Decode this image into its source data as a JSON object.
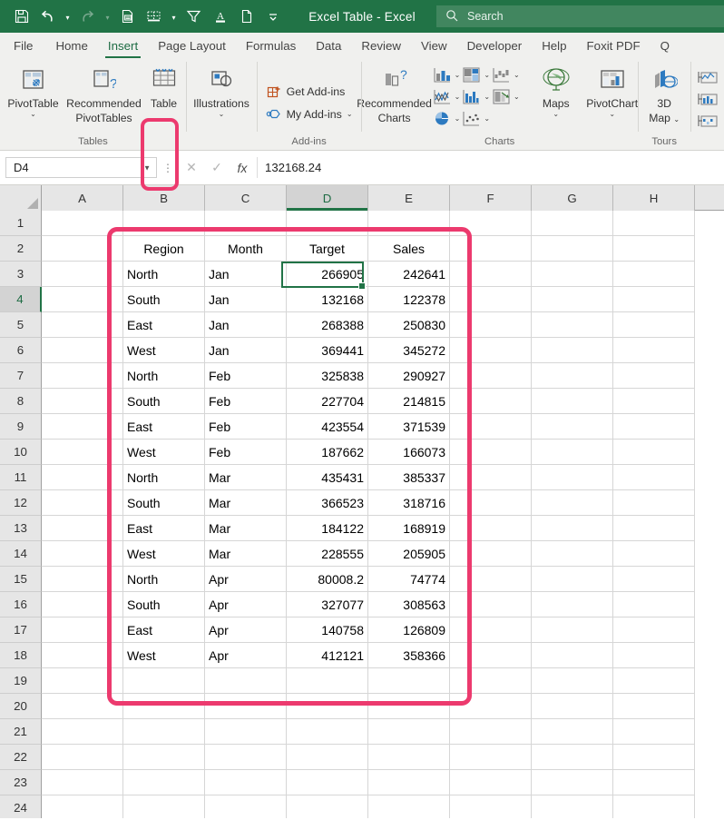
{
  "titlebar": {
    "title": "Excel Table  -  Excel",
    "quick_access": [
      {
        "name": "save-icon",
        "glyph": "💾",
        "dim": false,
        "caret": false
      },
      {
        "name": "undo-icon",
        "glyph": "↶",
        "dim": false,
        "caret": true
      },
      {
        "name": "redo-icon",
        "glyph": "↷",
        "dim": true,
        "caret": true
      },
      {
        "name": "print-preview-icon",
        "glyph": "🖶",
        "dim": false,
        "caret": false
      },
      {
        "name": "borders-icon",
        "glyph": "▦",
        "dim": false,
        "caret": true
      },
      {
        "name": "filter-icon",
        "glyph": "∇",
        "dim": false,
        "caret": false
      },
      {
        "name": "font-color-icon",
        "glyph": "A",
        "dim": false,
        "caret": false
      },
      {
        "name": "new-file-icon",
        "glyph": "□",
        "dim": false,
        "caret": false
      },
      {
        "name": "customize-qat-icon",
        "glyph": "⌄",
        "dim": false,
        "caret": false
      }
    ],
    "search": {
      "placeholder": "Search",
      "icon": "search-icon"
    }
  },
  "tabs": [
    {
      "label": "File",
      "active": false
    },
    {
      "label": "Home",
      "active": false
    },
    {
      "label": "Insert",
      "active": true
    },
    {
      "label": "Page Layout",
      "active": false
    },
    {
      "label": "Formulas",
      "active": false
    },
    {
      "label": "Data",
      "active": false
    },
    {
      "label": "Review",
      "active": false
    },
    {
      "label": "View",
      "active": false
    },
    {
      "label": "Developer",
      "active": false
    },
    {
      "label": "Help",
      "active": false
    },
    {
      "label": "Foxit PDF",
      "active": false
    },
    {
      "label": "Q",
      "active": false
    }
  ],
  "ribbon": {
    "groups": {
      "tables": {
        "label": "Tables",
        "pivot_table": "PivotTable",
        "recommended_pivot_tables": "Recommended\nPivotTables",
        "recommended_pivot_tables_l1": "Recommended",
        "recommended_pivot_tables_l2": "PivotTables",
        "table": "Table"
      },
      "illustrations": {
        "label": "",
        "illustrations": "Illustrations"
      },
      "addins": {
        "label": "Add-ins",
        "get_addins": "Get Add-ins",
        "my_addins": "My Add-ins"
      },
      "charts": {
        "label": "Charts",
        "recommended_charts_l1": "Recommended",
        "recommended_charts_l2": "Charts",
        "maps": "Maps",
        "pivot_chart": "PivotChart"
      },
      "tours": {
        "label": "Tours",
        "map_3d_l1": "3D",
        "map_3d_l2": "Map"
      }
    }
  },
  "formula_bar": {
    "name_box": "D4",
    "cancel_icon": "cancel-icon",
    "enter_icon": "confirm-icon",
    "fx_icon": "fx",
    "value": "132168.24"
  },
  "grid": {
    "columns": [
      "A",
      "B",
      "C",
      "D",
      "E",
      "F",
      "G",
      "H"
    ],
    "selected_column": "D",
    "selected_row": 4,
    "selected_cell": "D4",
    "rows": [
      1,
      2,
      3,
      4,
      5,
      6,
      7,
      8,
      9,
      10,
      11,
      12,
      13,
      14,
      15,
      16,
      17,
      18,
      19,
      20,
      21,
      22,
      23,
      24
    ],
    "table_header_row": 2,
    "table_headers": [
      "Region",
      "Month",
      "Target",
      "Sales"
    ],
    "table_rows": [
      {
        "row": 3,
        "region": "North",
        "month": "Jan",
        "target": "266905",
        "sales": "242641"
      },
      {
        "row": 4,
        "region": "South",
        "month": "Jan",
        "target": "132168",
        "sales": "122378"
      },
      {
        "row": 5,
        "region": "East",
        "month": "Jan",
        "target": "268388",
        "sales": "250830"
      },
      {
        "row": 6,
        "region": "West",
        "month": "Jan",
        "target": "369441",
        "sales": "345272"
      },
      {
        "row": 7,
        "region": "North",
        "month": "Feb",
        "target": "325838",
        "sales": "290927"
      },
      {
        "row": 8,
        "region": "South",
        "month": "Feb",
        "target": "227704",
        "sales": "214815"
      },
      {
        "row": 9,
        "region": "East",
        "month": "Feb",
        "target": "423554",
        "sales": "371539"
      },
      {
        "row": 10,
        "region": "West",
        "month": "Feb",
        "target": "187662",
        "sales": "166073"
      },
      {
        "row": 11,
        "region": "North",
        "month": "Mar",
        "target": "435431",
        "sales": "385337"
      },
      {
        "row": 12,
        "region": "South",
        "month": "Mar",
        "target": "366523",
        "sales": "318716"
      },
      {
        "row": 13,
        "region": "East",
        "month": "Mar",
        "target": "184122",
        "sales": "168919"
      },
      {
        "row": 14,
        "region": "West",
        "month": "Mar",
        "target": "228555",
        "sales": "205905"
      },
      {
        "row": 15,
        "region": "North",
        "month": "Apr",
        "target": "80008.2",
        "sales": "74774"
      },
      {
        "row": 16,
        "region": "South",
        "month": "Apr",
        "target": "327077",
        "sales": "308563"
      },
      {
        "row": 17,
        "region": "East",
        "month": "Apr",
        "target": "140758",
        "sales": "126809"
      },
      {
        "row": 18,
        "region": "West",
        "month": "Apr",
        "target": "412121",
        "sales": "358366"
      }
    ]
  },
  "annotations": {
    "highlight_color": "#ec3a6e",
    "table_button_highlight": "Table",
    "range_highlight": "B2:E19"
  }
}
